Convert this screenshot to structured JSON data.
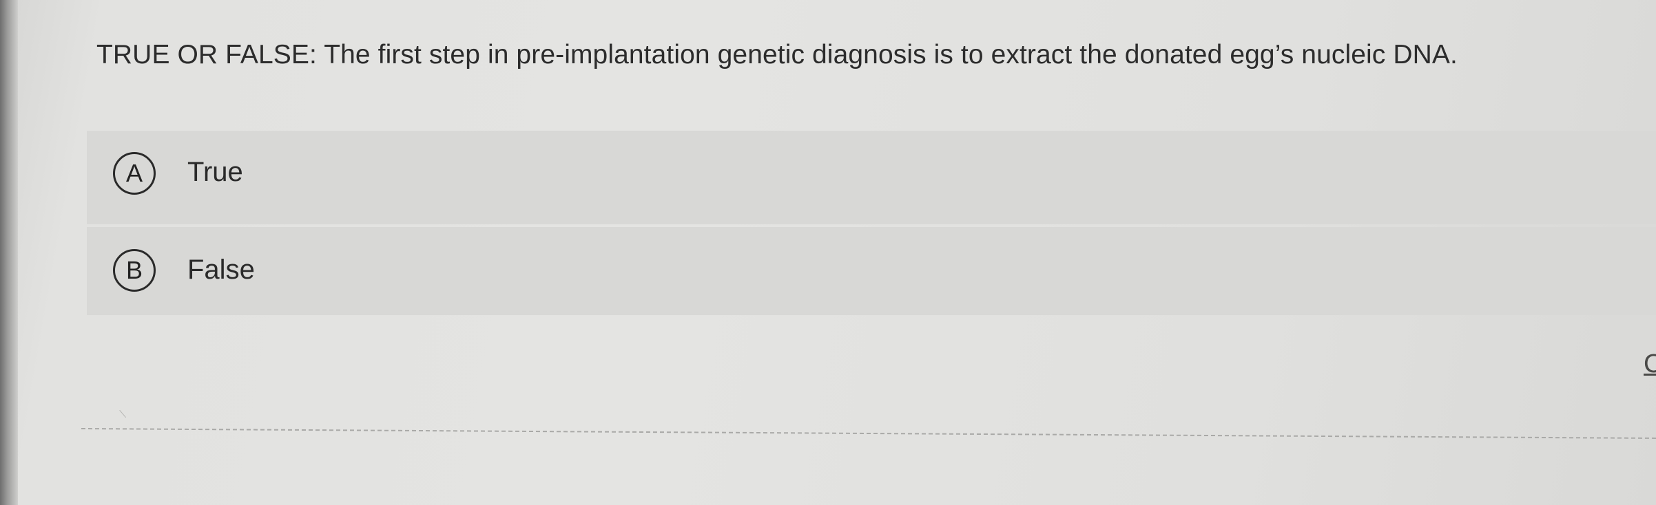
{
  "question": {
    "text": "TRUE OR FALSE: The first step in pre-implantation genetic diagnosis is to extract the donated egg’s nucleic DNA."
  },
  "choices": [
    {
      "letter": "A",
      "label": "True"
    },
    {
      "letter": "B",
      "label": "False"
    }
  ],
  "edge_glyph": "C"
}
